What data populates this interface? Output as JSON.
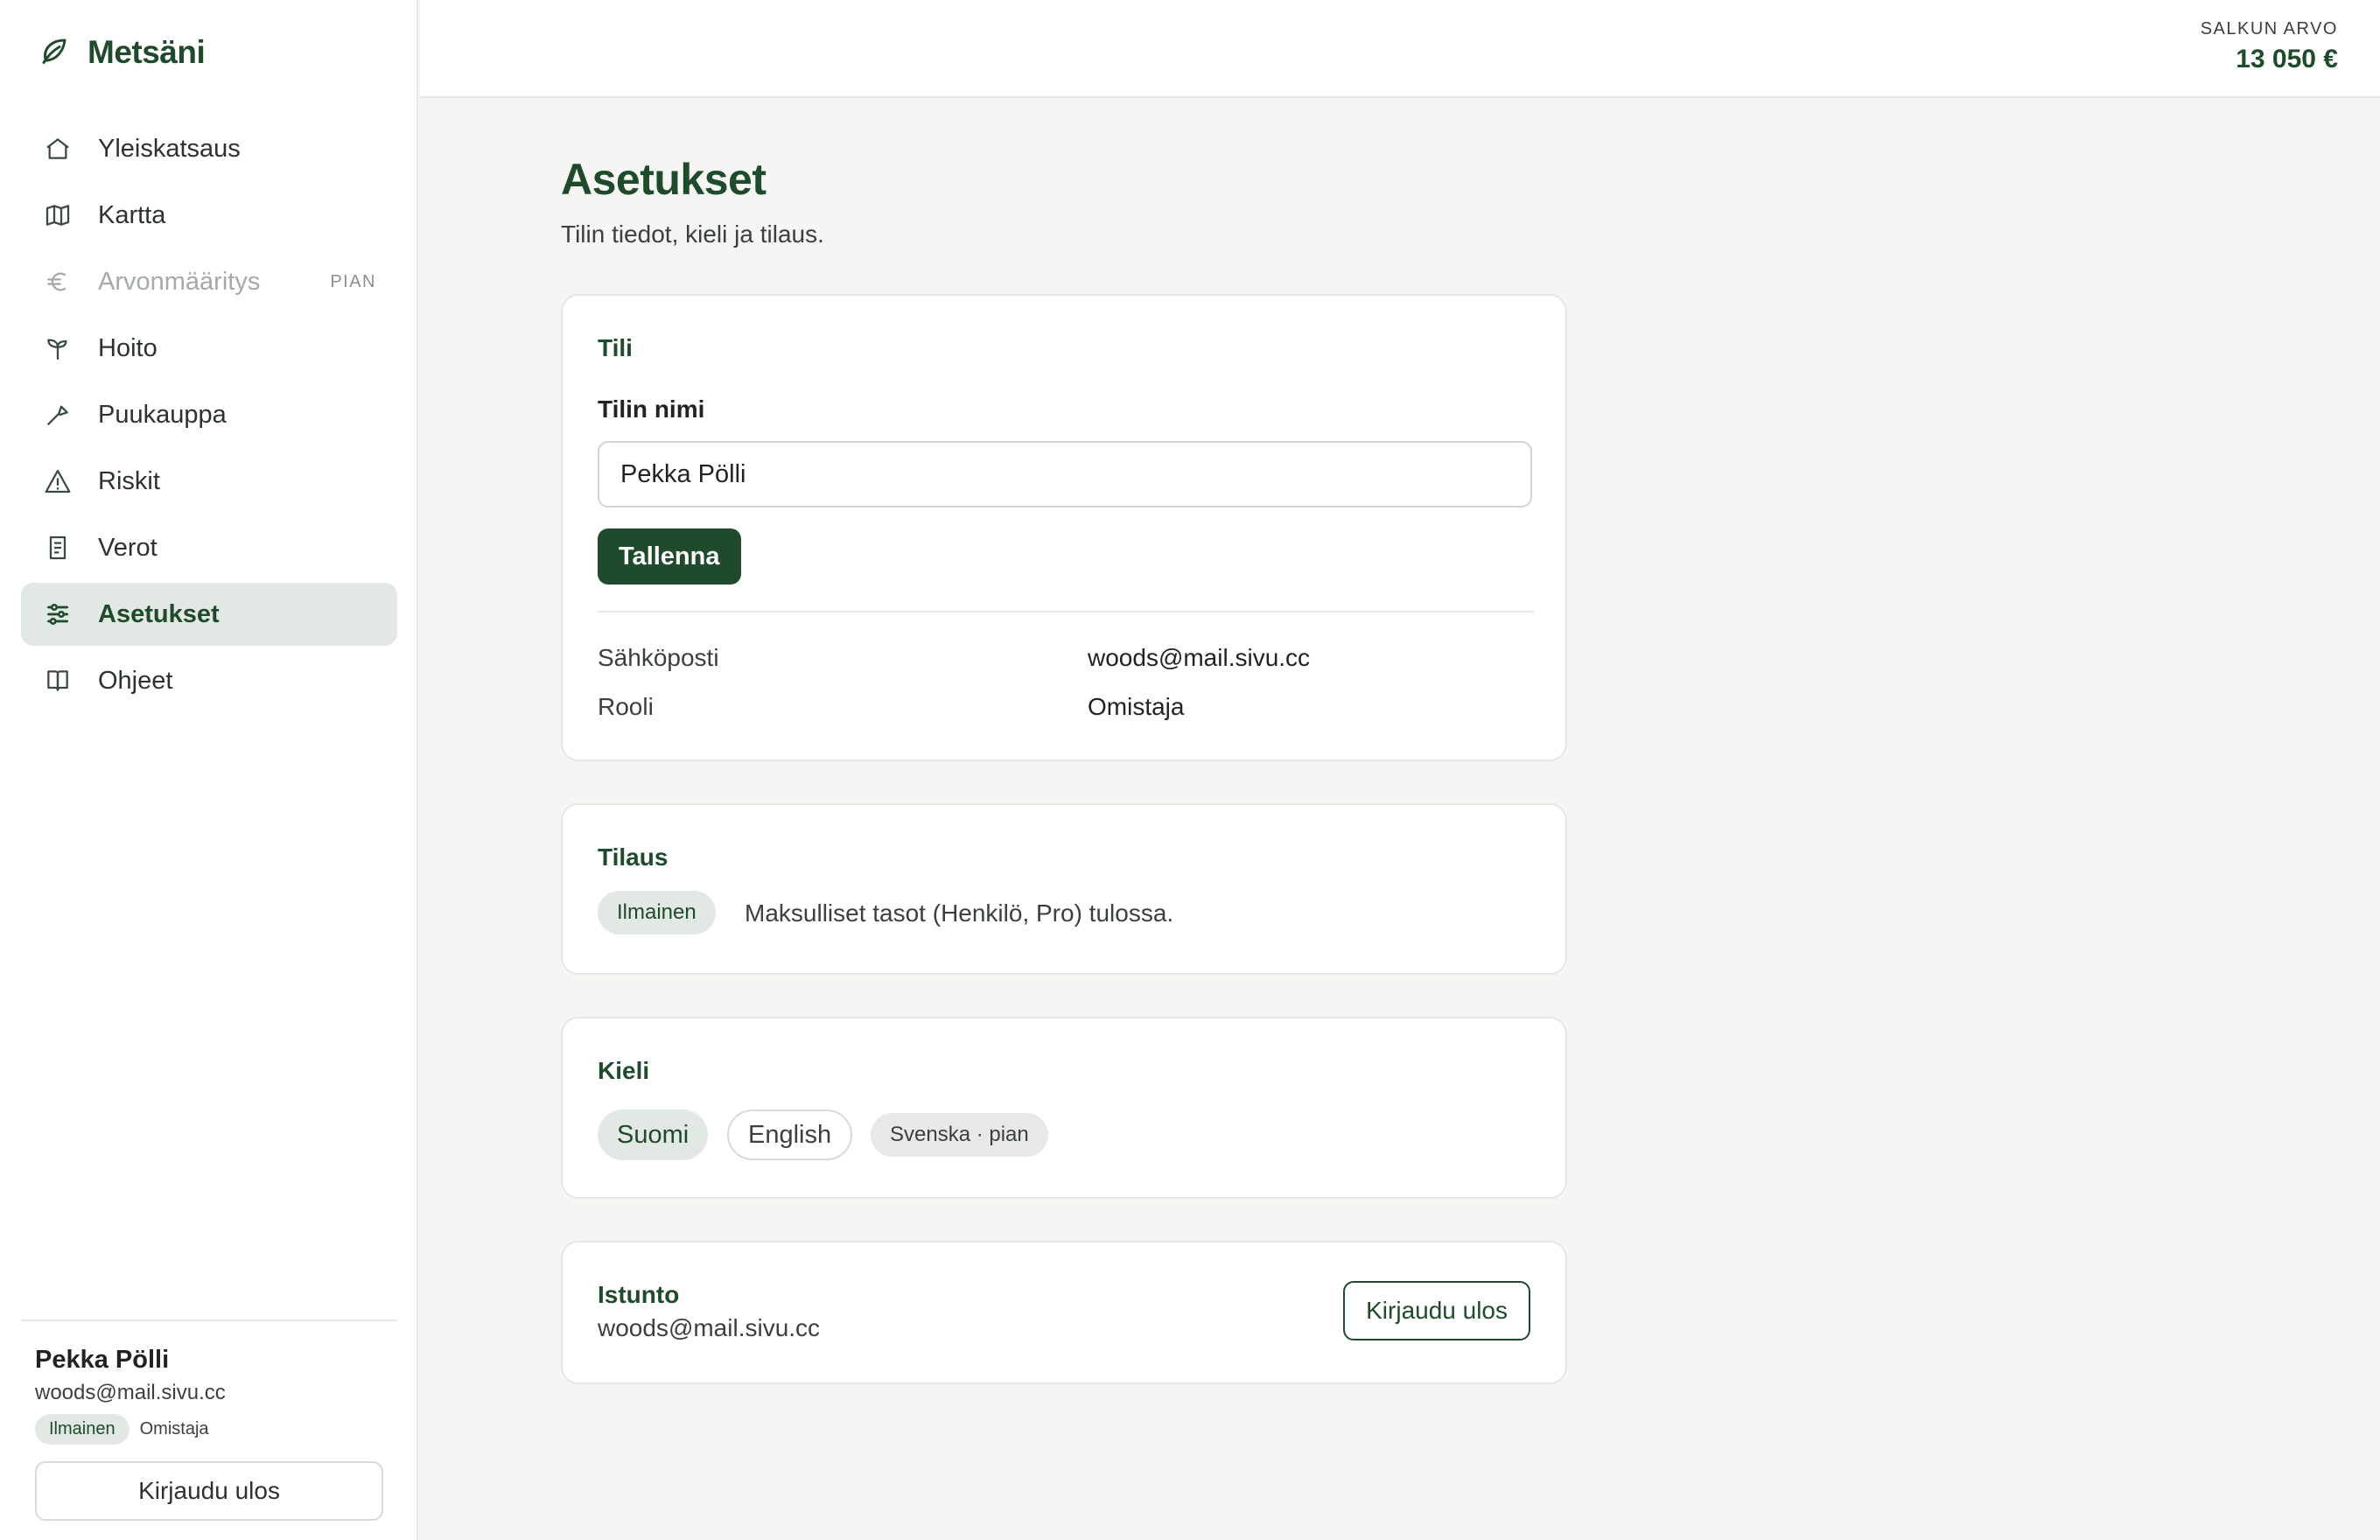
{
  "app": {
    "name": "Metsäni",
    "logo_icon": "leaf-icon"
  },
  "header": {
    "portfolio_label": "SALKUN ARVO",
    "portfolio_value": "13 050 €"
  },
  "sidebar": {
    "items": [
      {
        "label": "Yleiskatsaus",
        "icon": "home-icon"
      },
      {
        "label": "Kartta",
        "icon": "map-icon"
      },
      {
        "label": "Arvonmääritys",
        "icon": "euro-icon",
        "badge": "PIAN",
        "disabled": true
      },
      {
        "label": "Hoito",
        "icon": "sprout-icon"
      },
      {
        "label": "Puukauppa",
        "icon": "axe-icon"
      },
      {
        "label": "Riskit",
        "icon": "warning-icon"
      },
      {
        "label": "Verot",
        "icon": "receipt-icon"
      },
      {
        "label": "Asetukset",
        "icon": "sliders-icon",
        "active": true
      },
      {
        "label": "Ohjeet",
        "icon": "book-icon"
      }
    ],
    "user": {
      "name": "Pekka Pölli",
      "email": "woods@mail.sivu.cc",
      "plan": "Ilmainen",
      "role": "Omistaja",
      "logout_label": "Kirjaudu ulos"
    }
  },
  "main": {
    "title": "Asetukset",
    "subtitle": "Tilin tiedot, kieli ja tilaus.",
    "account": {
      "title": "Tili",
      "name_label": "Tilin nimi",
      "name_value": "Pekka Pölli",
      "save_label": "Tallenna",
      "email_key": "Sähköposti",
      "email_value": "woods@mail.sivu.cc",
      "role_key": "Rooli",
      "role_value": "Omistaja"
    },
    "subscription": {
      "title": "Tilaus",
      "plan_badge": "Ilmainen",
      "text": "Maksulliset tasot (Henkilö, Pro) tulossa."
    },
    "language": {
      "title": "Kieli",
      "options": [
        "Suomi",
        "English",
        "Svenska · pian"
      ],
      "selected": "Suomi"
    },
    "session": {
      "title": "Istunto",
      "email": "woods@mail.sivu.cc",
      "logout_label": "Kirjaudu ulos"
    }
  },
  "colors": {
    "brand": "#1f4a2c",
    "active_bg": "#e2e8e3",
    "page_bg": "#f5f5f3"
  }
}
